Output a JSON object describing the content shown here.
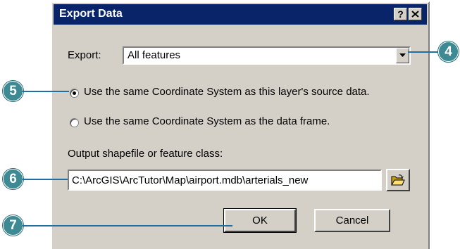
{
  "dialog": {
    "title": "Export Data",
    "help_button": "?",
    "export_label": "Export:",
    "export_value": "All features",
    "radio_options": [
      {
        "label": "Use the same Coordinate System as this layer's source data.",
        "selected": true
      },
      {
        "label": "Use the same Coordinate System as the data frame.",
        "selected": false
      }
    ],
    "output_label": "Output shapefile or feature class:",
    "output_value": "C:\\ArcGIS\\ArcTutor\\Map\\airport.mdb\\arterials_new",
    "ok_label": "OK",
    "cancel_label": "Cancel"
  },
  "callouts": {
    "c4": "4",
    "c5": "5",
    "c6": "6",
    "c7": "7"
  },
  "colors": {
    "title_bar": "#0a246a",
    "dialog_bg": "#d4d0c8",
    "callout": "#3d8a94",
    "leader": "#1f6fa5"
  }
}
